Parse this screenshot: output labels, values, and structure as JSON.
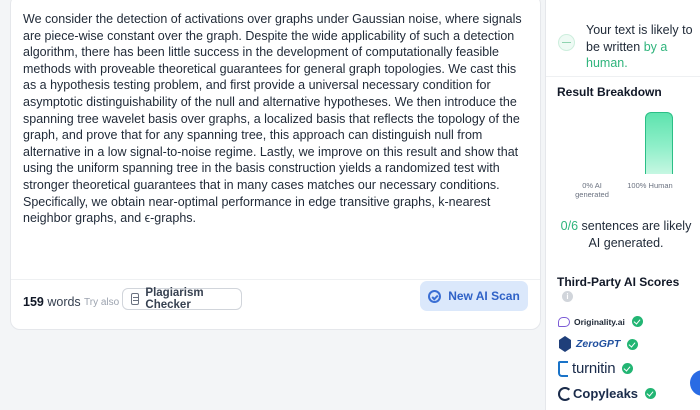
{
  "editor": {
    "text": "We consider the detection of activations over graphs under Gaussian noise, where signals are piece-wise constant over the graph. Despite the wide applicability of such a detection algorithm, there has been little success in the development of computationally feasible methods with proveable theoretical guarantees for general graph topologies. We cast this as a hypothesis testing problem, and first provide a universal necessary condition for asymptotic distinguishability of the null and alternative hypotheses. We then introduce the spanning tree wavelet basis over graphs, a localized basis that reflects the topology of the graph, and prove that for any spanning tree, this approach can distinguish null from alternative in a low signal-to-noise regime. Lastly, we improve on this result and show that using the uniform spanning tree in the basis construction yields a randomized test with stronger theoretical guarantees that in many cases matches our necessary conditions. Specifically, we obtain near-optimal performance in edge transitive graphs, k-nearest neighbor graphs, and ϵ-graphs.",
    "word_count": "159",
    "word_count_suffix": "words",
    "try_also": "Try also",
    "plagiarism_label": "Plagiarism Checker",
    "scan_label": "New AI Scan"
  },
  "results": {
    "verdict_prefix": "Your text is likely to be written",
    "verdict_highlight": "by a human.",
    "breakdown_title": "Result Breakdown",
    "ai_percent": 0,
    "human_percent": 100,
    "ai_label": "0% AI generated",
    "human_label": "100% Human",
    "sentences_count": "0/6",
    "sentences_text": "sentences are likely AI generated.",
    "third_party_title": "Third-Party AI Scores",
    "info_glyph": "i",
    "detectors": [
      {
        "name": "Originality.ai",
        "icon": "originality-logo",
        "status": "passed"
      },
      {
        "name": "ZeroGPT",
        "icon": "zerogpt-logo",
        "status": "passed"
      },
      {
        "name": "turnitin",
        "icon": "turnitin-logo",
        "status": "passed"
      },
      {
        "name": "Copyleaks",
        "icon": "copyleaks-logo",
        "status": "passed"
      }
    ]
  },
  "colors": {
    "accent_green": "#2fb47c",
    "accent_blue": "#2f62c7",
    "check_green": "#22b573"
  }
}
